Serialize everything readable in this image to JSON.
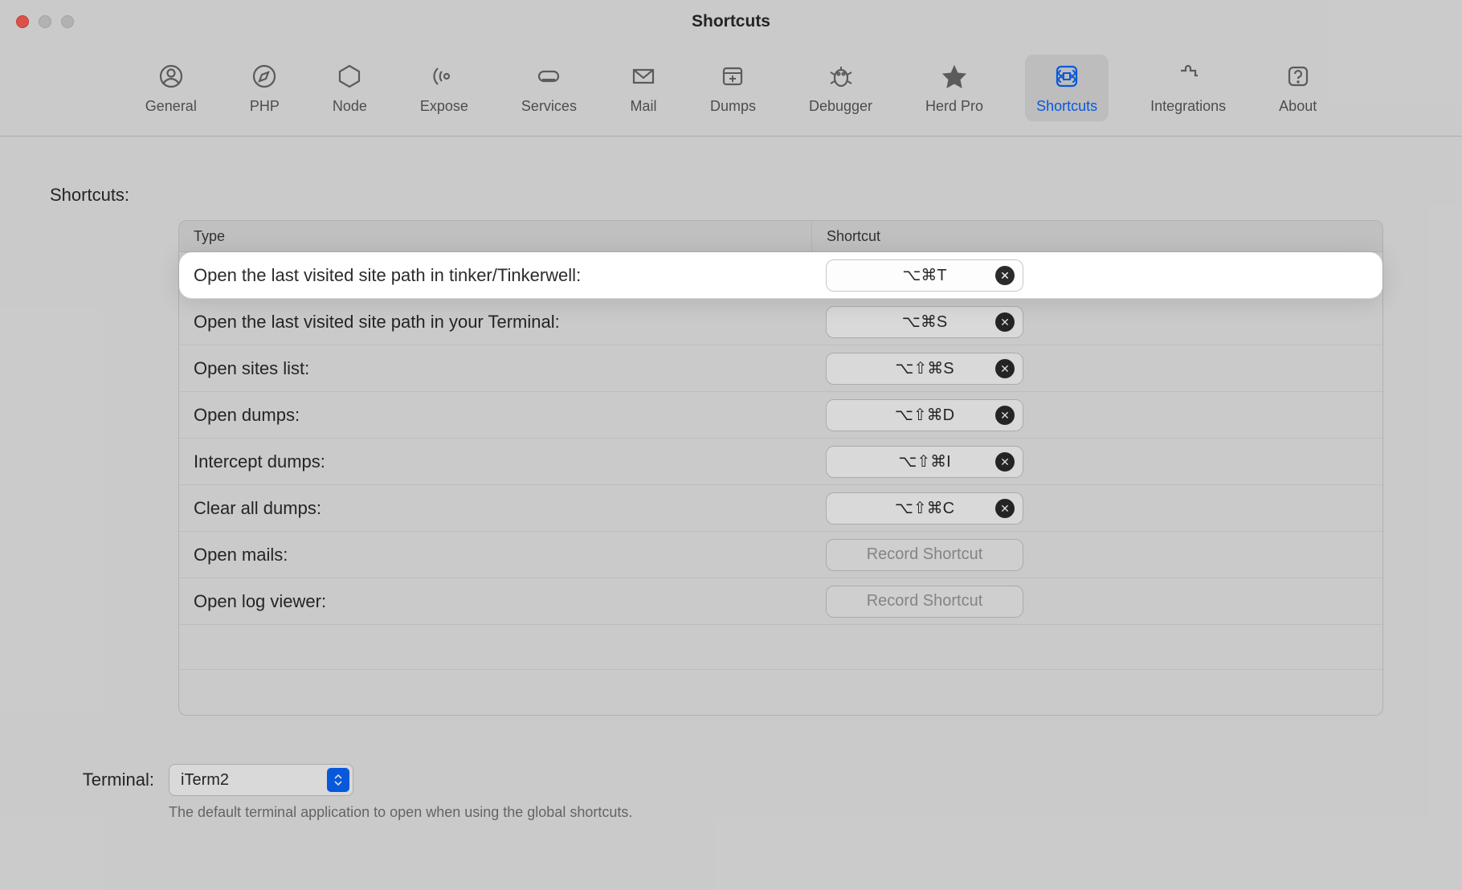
{
  "window": {
    "title": "Shortcuts"
  },
  "tabs": [
    {
      "id": "general",
      "label": "General"
    },
    {
      "id": "php",
      "label": "PHP"
    },
    {
      "id": "node",
      "label": "Node"
    },
    {
      "id": "expose",
      "label": "Expose"
    },
    {
      "id": "services",
      "label": "Services"
    },
    {
      "id": "mail",
      "label": "Mail"
    },
    {
      "id": "dumps",
      "label": "Dumps"
    },
    {
      "id": "debugger",
      "label": "Debugger"
    },
    {
      "id": "herdpro",
      "label": "Herd Pro"
    },
    {
      "id": "shortcuts",
      "label": "Shortcuts",
      "active": true
    },
    {
      "id": "integrations",
      "label": "Integrations"
    },
    {
      "id": "about",
      "label": "About"
    }
  ],
  "section": {
    "label": "Shortcuts:",
    "headers": {
      "type": "Type",
      "shortcut": "Shortcut"
    }
  },
  "shortcuts": [
    {
      "label": "Open the last visited site path in tinker/Tinkerwell:",
      "keys": "⌥⌘T",
      "highlight": true
    },
    {
      "label": "Open the last visited site path in your Terminal:",
      "keys": "⌥⌘S"
    },
    {
      "label": "Open sites list:",
      "keys": "⌥⇧⌘S"
    },
    {
      "label": "Open dumps:",
      "keys": "⌥⇧⌘D"
    },
    {
      "label": "Intercept dumps:",
      "keys": "⌥⇧⌘I"
    },
    {
      "label": "Clear all dumps:",
      "keys": "⌥⇧⌘C"
    },
    {
      "label": "Open mails:",
      "keys": null,
      "placeholder": "Record Shortcut"
    },
    {
      "label": "Open log viewer:",
      "keys": null,
      "placeholder": "Record Shortcut"
    }
  ],
  "terminal": {
    "label": "Terminal:",
    "selected": "iTerm2",
    "hint": "The default terminal application to open when using the global shortcuts."
  }
}
